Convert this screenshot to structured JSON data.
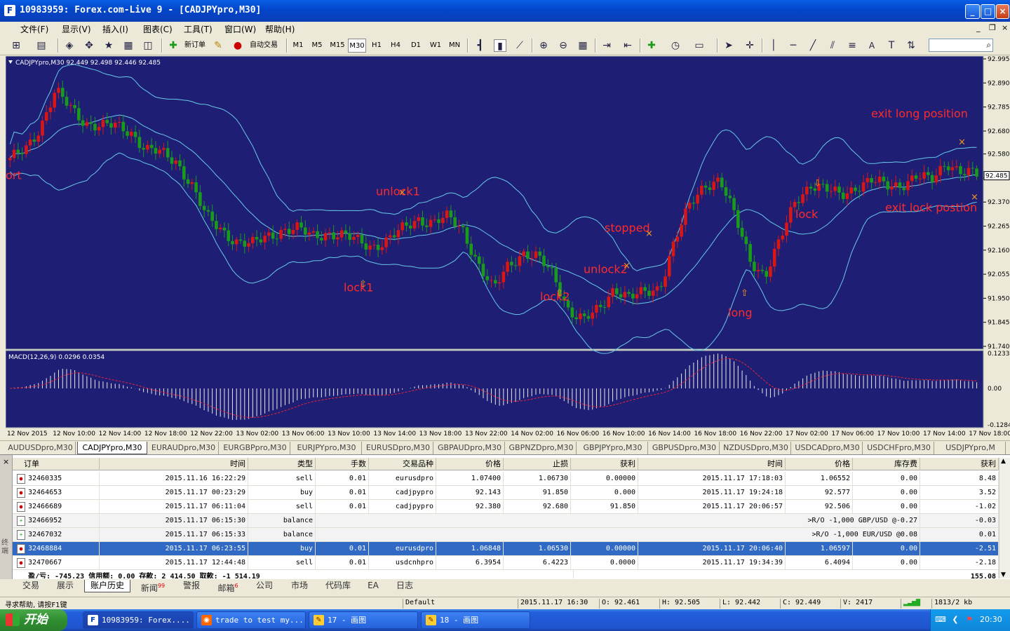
{
  "window": {
    "title": "10983959: Forex.com-Live 9 - [CADJPYpro,M30]",
    "app_icon": "F"
  },
  "menu": [
    "文件(F)",
    "显示(V)",
    "插入(I)",
    "图表(C)",
    "工具(T)",
    "窗口(W)",
    "帮助(H)"
  ],
  "toolbar": {
    "new_order": "新订单",
    "auto_trading": "自动交易",
    "timeframes": [
      "M1",
      "M5",
      "M15",
      "M30",
      "H1",
      "H4",
      "D1",
      "W1",
      "MN"
    ],
    "active_timeframe": "M30",
    "drawing_tools": [
      "A"
    ]
  },
  "chart_data": {
    "type": "candlestick",
    "symbol_header": "CADJPYpro,M30  92.449 92.498 92.446 92.485",
    "price_ticks": [
      "92.995",
      "92.890",
      "92.785",
      "92.680",
      "92.580",
      "92.475",
      "92.370",
      "92.265",
      "92.160",
      "92.055",
      "91.950",
      "91.845",
      "91.740"
    ],
    "current_price": "92.485",
    "ylim": [
      91.74,
      92.995
    ],
    "time_labels": [
      "12 Nov 2015",
      "12 Nov 10:00",
      "12 Nov 14:00",
      "12 Nov 18:00",
      "12 Nov 22:00",
      "13 Nov 02:00",
      "13 Nov 06:00",
      "13 Nov 10:00",
      "13 Nov 14:00",
      "13 Nov 18:00",
      "13 Nov 22:00",
      "14 Nov 02:00",
      "16 Nov 06:00",
      "16 Nov 10:00",
      "16 Nov 14:00",
      "16 Nov 18:00",
      "16 Nov 22:00",
      "17 Nov 02:00",
      "17 Nov 06:00",
      "17 Nov 10:00",
      "17 Nov 14:00",
      "17 Nov 18:00"
    ],
    "close_path": [
      92.55,
      92.6,
      92.7,
      92.85,
      92.78,
      92.72,
      92.7,
      92.7,
      92.68,
      92.6,
      92.58,
      92.55,
      92.45,
      92.3,
      92.25,
      92.2,
      92.18,
      92.22,
      92.25,
      92.25,
      92.22,
      92.24,
      92.22,
      92.2,
      92.18,
      92.2,
      92.25,
      92.3,
      92.28,
      92.3,
      92.25,
      92.1,
      91.98,
      92.1,
      92.15,
      92.12,
      92.05,
      91.9,
      91.85,
      91.9,
      92.0,
      91.95,
      91.97,
      92.0,
      92.2,
      92.35,
      92.45,
      92.47,
      92.3,
      92.12,
      92.05,
      92.2,
      92.38,
      92.45,
      92.42,
      92.4,
      92.44,
      92.46,
      92.44,
      92.45,
      92.48,
      92.46,
      92.55,
      92.5,
      92.485
    ],
    "annotations": [
      {
        "label": "ort",
        "price": 92.47
      },
      {
        "label": "unlock1",
        "price": 92.4
      },
      {
        "label": "lock1",
        "price": 91.98
      },
      {
        "label": "lock2",
        "price": 91.94
      },
      {
        "label": "unlock2",
        "price": 92.06
      },
      {
        "label": "stopped",
        "price": 92.24
      },
      {
        "label": "long",
        "price": 91.87
      },
      {
        "label": "lock",
        "price": 92.3
      },
      {
        "label": "exit long position",
        "price": 92.74
      },
      {
        "label": "exit lock postion",
        "price": 92.33
      }
    ],
    "macd": {
      "header": "MACD(12,26,9) 0.0296 0.0354",
      "ticks": [
        "0.1233",
        "0.00",
        "-0.1284"
      ],
      "ylim": [
        -0.1284,
        0.1233
      ]
    },
    "colors": {
      "background": "#1e1f74",
      "bull": "#d81616",
      "bear": "#1a9a1a",
      "bands": "#68c9e8",
      "annotation": "#ff2a2a",
      "marker": "#ff9a1a"
    }
  },
  "symbol_tabs": [
    "AUDUSDpro,M30",
    "CADJPYpro,M30",
    "EURAUDpro,M30",
    "EURGBPpro,M30",
    "EURJPYpro,M30",
    "EURUSDpro,M30",
    "GBPAUDpro,M30",
    "GBPNZDpro,M30",
    "GBPJPYpro,M30",
    "GBPUSDpro,M30",
    "NZDUSDpro,M30",
    "USDCADpro,M30",
    "USDCHFpro,M30",
    "USDJPYpro,M"
  ],
  "active_symbol_tab": 1,
  "history": {
    "headers": [
      "订单",
      "时间",
      "类型",
      "手数",
      "交易品种",
      "价格",
      "止损",
      "获利",
      "时间",
      "价格",
      "库存费",
      "获利"
    ],
    "rows": [
      [
        "32460335",
        "2015.11.16 16:22:29",
        "sell",
        "0.01",
        "eurusdpro",
        "1.07400",
        "1.06730",
        "0.00000",
        "2015.11.17 17:18:03",
        "1.06552",
        "0.00",
        "8.48"
      ],
      [
        "32464653",
        "2015.11.17 00:23:29",
        "buy",
        "0.01",
        "cadjpypro",
        "92.143",
        "91.850",
        "0.000",
        "2015.11.17 19:24:18",
        "92.577",
        "0.00",
        "3.52"
      ],
      [
        "32466689",
        "2015.11.17 06:11:04",
        "sell",
        "0.01",
        "cadjpypro",
        "92.380",
        "92.680",
        "91.850",
        "2015.11.17 20:06:57",
        "92.506",
        "0.00",
        "-1.02"
      ],
      [
        "32466952",
        "2015.11.17 06:15:30",
        "balance",
        "",
        "",
        "",
        "",
        "",
        "",
        ">R/O -1,000 GBP/USD @-0.27",
        "",
        "-0.03"
      ],
      [
        "32467032",
        "2015.11.17 06:15:33",
        "balance",
        "",
        "",
        "",
        "",
        "",
        "",
        ">R/O -1,000 EUR/USD @0.08",
        "",
        "0.01"
      ],
      [
        "32468884",
        "2015.11.17 06:23:55",
        "buy",
        "0.01",
        "eurusdpro",
        "1.06848",
        "1.06530",
        "0.00000",
        "2015.11.17 20:06:40",
        "1.06597",
        "0.00",
        "-2.51"
      ],
      [
        "32470667",
        "2015.11.17 12:44:48",
        "sell",
        "0.01",
        "usdcnhpro",
        "6.3954",
        "6.4223",
        "0.0000",
        "2015.11.17 19:34:39",
        "6.4094",
        "0.00",
        "-2.18"
      ]
    ],
    "selected_row": 5,
    "summary": "盈/亏: -745.23  信用额: 0.00  存款: 2 414.50  取款: -1 514.19",
    "summary_total": "155.08"
  },
  "terminal_tabs": [
    {
      "label": "交易",
      "badge": ""
    },
    {
      "label": "展示",
      "badge": ""
    },
    {
      "label": "账户历史",
      "badge": ""
    },
    {
      "label": "新闻",
      "badge": "99"
    },
    {
      "label": "警报",
      "badge": ""
    },
    {
      "label": "邮箱",
      "badge": "6"
    },
    {
      "label": "公司",
      "badge": ""
    },
    {
      "label": "市场",
      "badge": ""
    },
    {
      "label": "代码库",
      "badge": ""
    },
    {
      "label": "EA",
      "badge": ""
    },
    {
      "label": "日志",
      "badge": ""
    }
  ],
  "active_terminal_tab": 2,
  "terminal_side_label": "终端",
  "status": {
    "help": "寻求帮助, 请按F1键",
    "profile": "Default",
    "datetime": "2015.11.17 16:30",
    "open": "O: 92.461",
    "high": "H: 92.505",
    "low": "L: 92.442",
    "close": "C: 92.449",
    "volume": "V: 2417",
    "traffic": "1813/2 kb"
  },
  "taskbar": {
    "start": "开始",
    "tasks": [
      "10983959: Forex....",
      "trade to test my...",
      "17 - 画图",
      "18 - 画图"
    ],
    "clock": "20:30"
  }
}
